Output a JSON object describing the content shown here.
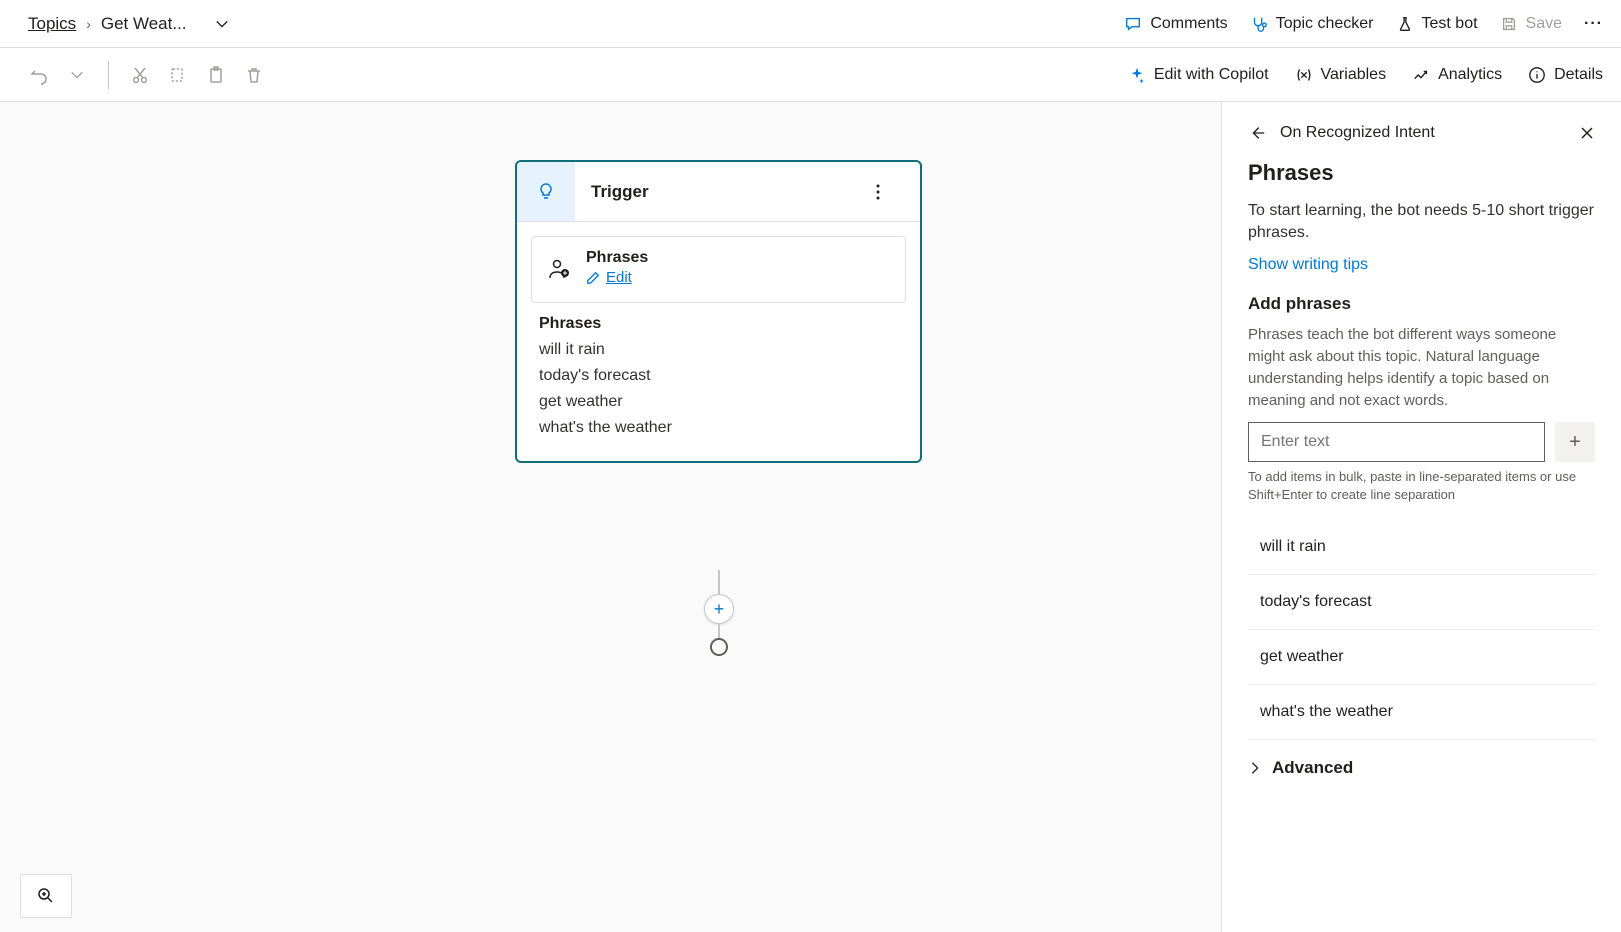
{
  "breadcrumb": {
    "root": "Topics",
    "current": "Get Weat..."
  },
  "topActions": {
    "comments": "Comments",
    "topicChecker": "Topic checker",
    "testBot": "Test bot",
    "save": "Save"
  },
  "toolbar2": {
    "editCopilot": "Edit with Copilot",
    "variables": "Variables",
    "analytics": "Analytics",
    "details": "Details"
  },
  "trigger": {
    "title": "Trigger",
    "phrasesLabel": "Phrases",
    "editLabel": "Edit",
    "listHeader": "Phrases",
    "items": [
      "will it rain",
      "today's forecast",
      "get weather",
      "what's the weather"
    ]
  },
  "panel": {
    "title": "On Recognized Intent",
    "heading": "Phrases",
    "help": "To start learning, the bot needs 5-10 short trigger phrases.",
    "tipsLink": "Show writing tips",
    "addHeading": "Add phrases",
    "help2": "Phrases teach the bot different ways someone might ask about this topic. Natural language understanding helps identify a topic based on meaning and not exact words.",
    "inputPlaceholder": "Enter text",
    "hint": "To add items in bulk, paste in line-separated items or use Shift+Enter to create line separation",
    "items": [
      "will it rain",
      "today's forecast",
      "get weather",
      "what's the weather"
    ],
    "advanced": "Advanced"
  }
}
